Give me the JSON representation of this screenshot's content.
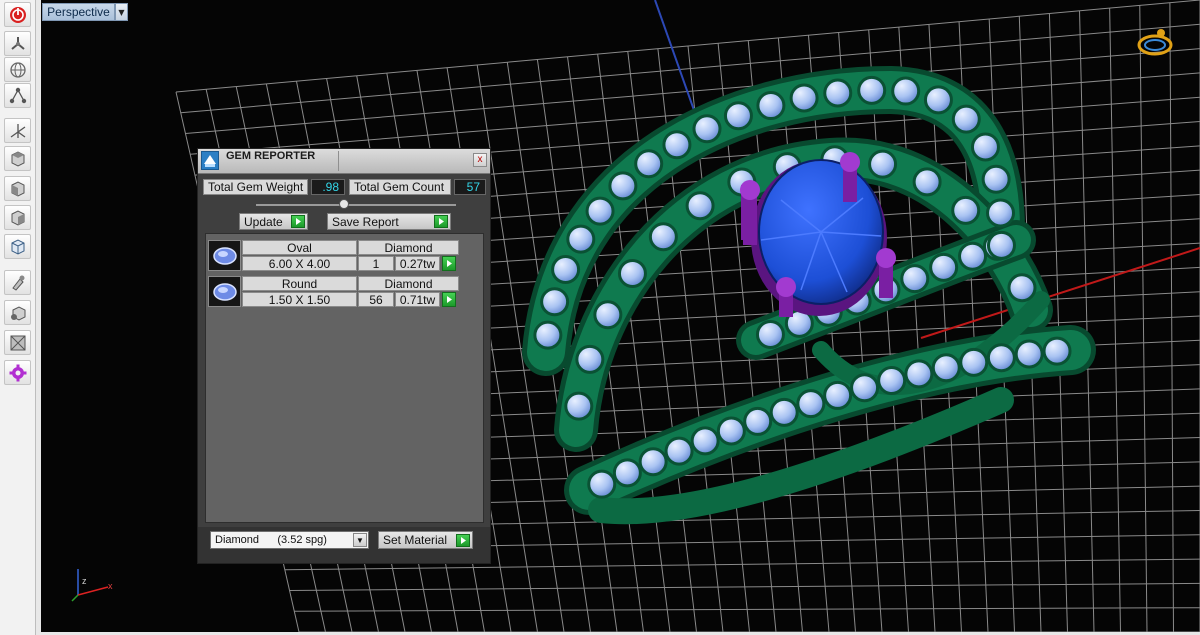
{
  "viewport": {
    "tab_label": "Perspective",
    "axis_labels": {
      "z": "z",
      "x": "x"
    }
  },
  "toolbar": {
    "icons": [
      "power-icon",
      "fan-icon",
      "globe-icon",
      "nodes-icon",
      "axes-icon",
      "cube-top-icon",
      "cube-front-icon",
      "cube-side-icon",
      "cube-persp-icon",
      "brush-icon",
      "cube-material-icon",
      "box-icon",
      "gear-plus-icon"
    ]
  },
  "gem_reporter": {
    "title": "GEM REPORTER",
    "close_label": "x",
    "total_weight_label": "Total Gem Weight",
    "total_weight_value": ".98",
    "total_count_label": "Total Gem Count",
    "total_count_value": "57",
    "update_label": "Update",
    "save_report_label": "Save Report",
    "gems": [
      {
        "shape": "Oval",
        "size": "6.00 X 4.00",
        "material": "Diamond",
        "count": "1",
        "weight": "0.27tw"
      },
      {
        "shape": "Round",
        "size": "1.50 X 1.50",
        "material": "Diamond",
        "count": "56",
        "weight": "0.71tw"
      }
    ],
    "material_select": "Diamond      (3.52 spg)",
    "set_material_label": "Set Material"
  },
  "colors": {
    "metal": "#0f7a4f",
    "center_gem": "#1d4fd6",
    "prongs": "#7a1fa3",
    "small_gems": "#a9c3f2",
    "grid": "#8a8a8a"
  }
}
